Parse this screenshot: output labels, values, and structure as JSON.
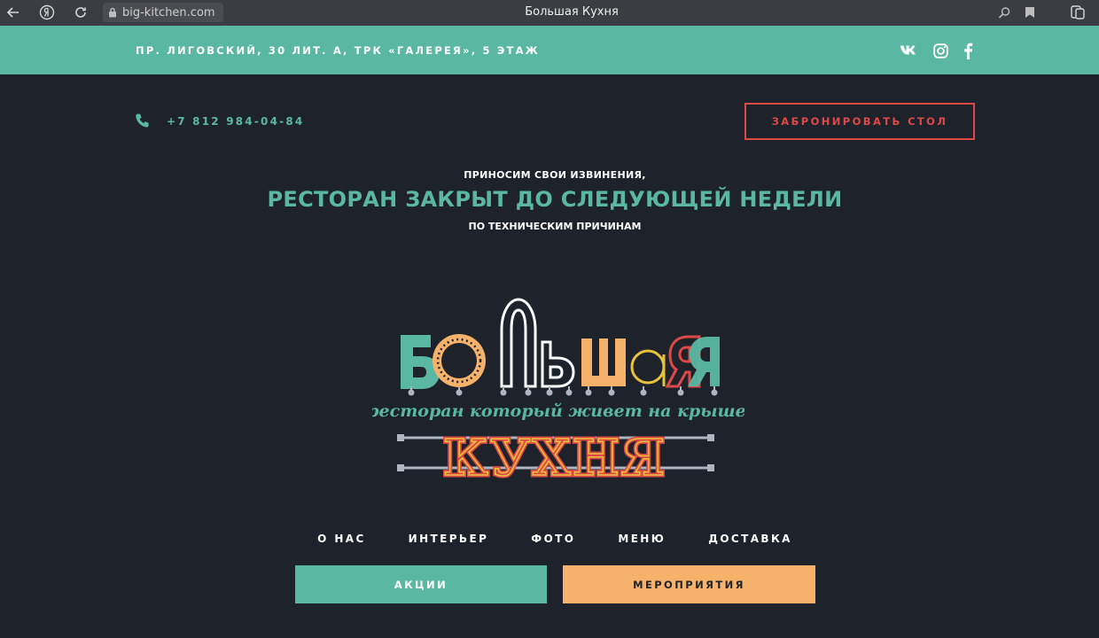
{
  "browser": {
    "url": "big-kitchen.com",
    "title": "Большая Кухня"
  },
  "header": {
    "address": "ПР. ЛИГОВСКИЙ, 30 ЛИТ. А, ТРК «ГАЛЕРЕЯ», 5 ЭТАЖ",
    "social": [
      "vk-icon",
      "instagram-icon",
      "facebook-icon"
    ]
  },
  "contact": {
    "phone": "+7 812 984-04-84",
    "reserve_label": "ЗАБРОНИРОВАТЬ СТОЛ"
  },
  "notice": {
    "line1": "ПРИНОСИМ СВОИ ИЗВИНЕНИЯ,",
    "headline": "РЕСТОРАН ЗАКРЫТ ДО СЛЕДУЮЩЕЙ НЕДЕЛИ",
    "line3": "ПО ТЕХНИЧЕСКИМ ПРИЧИНАМ"
  },
  "logo": {
    "word1": "БОЛЬШАЯ",
    "tagline": "ресторан который живет на крыше",
    "word2": "КУХНЯ"
  },
  "nav": {
    "items": [
      "О НАС",
      "ИНТЕРЬЕР",
      "ФОТО",
      "МЕНЮ",
      "ДОСТАВКА"
    ]
  },
  "actions": {
    "promos_label": "АКЦИИ",
    "events_label": "МЕРОПРИЯТИЯ"
  },
  "colors": {
    "background": "#1e232b",
    "teal": "#5ab8a2",
    "red": "#e04848",
    "orange": "#f6b16a",
    "yellow": "#e8c23a"
  }
}
